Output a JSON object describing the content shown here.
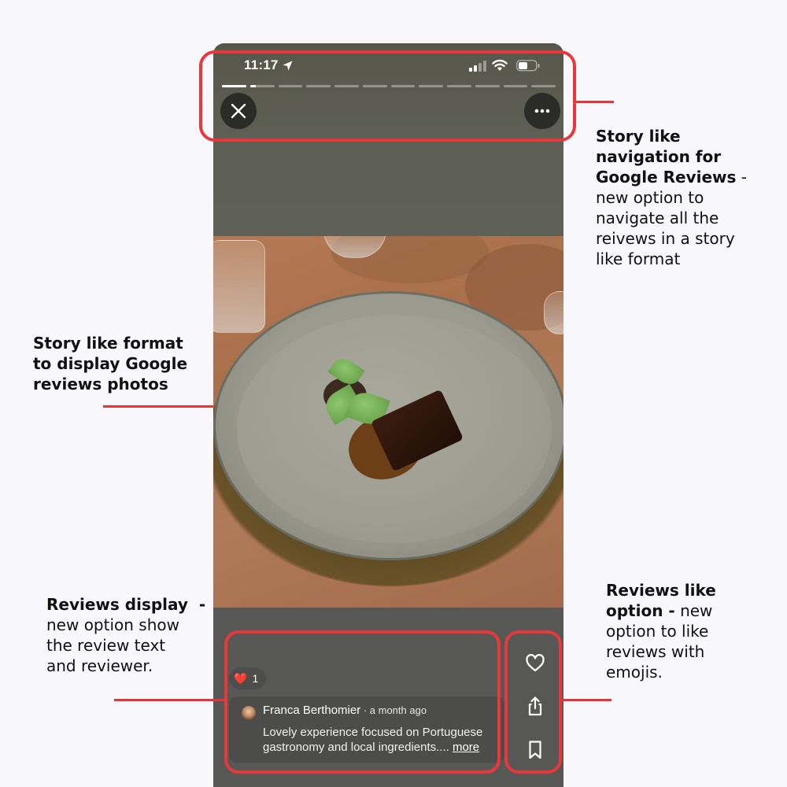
{
  "status_bar": {
    "time": "11:17",
    "location_icon": "location-arrow-icon",
    "signal_icon": "cellular-signal-icon",
    "wifi_icon": "wifi-icon",
    "battery_icon": "battery-icon"
  },
  "story_progress": {
    "total_segments": 12,
    "current_index": 1,
    "segment_fill": [
      1,
      0.25,
      0,
      0,
      0,
      0,
      0,
      0,
      0,
      0,
      0,
      0
    ]
  },
  "top_controls": {
    "close_icon": "close-x-icon",
    "more_icon": "more-horizontal-icon"
  },
  "photo": {
    "description": "Plated dish: dark braised meat block with sauce and green leaves on grey stone plate, on wooden table with glasses"
  },
  "review": {
    "reaction_emoji": "❤️",
    "reaction_count": "1",
    "reviewer_name": "Franca Berthomier",
    "separator": " · ",
    "time_ago": "a month ago",
    "text_line1": "Lovely experience focused on Portuguese",
    "text_line2": "gastronomy and local ingredients.... ",
    "more_label": "more"
  },
  "side_actions": {
    "like_icon": "heart-outline-icon",
    "share_icon": "share-icon",
    "save_icon": "bookmark-icon"
  },
  "annotations": {
    "navigation": {
      "title_line1": "Story like",
      "title_line2": "navigation for",
      "title_line3": "Google Reviews",
      "dash": " -",
      "body_line1": "new option to",
      "body_line2": "navigate all the",
      "body_line3": "reivews in a story",
      "body_line4": "like format"
    },
    "photos": {
      "line1": "Story like format",
      "line2": "to display Google",
      "line3": "reviews photos"
    },
    "reviews_display": {
      "title": "Reviews display",
      "dash": "  -",
      "body_line1": "new option show",
      "body_line2": "the review text",
      "body_line3": "and reviewer."
    },
    "like_option": {
      "title_line1": "Reviews like",
      "title_line2": "option -",
      "body_inline": " new",
      "body_line1": "option to like",
      "body_line2": "reviews with",
      "body_line3": "emojis."
    }
  },
  "colors": {
    "annotation_red": "#e8383b",
    "phone_bg": "#575855",
    "button_bg": "#2b2b27"
  }
}
